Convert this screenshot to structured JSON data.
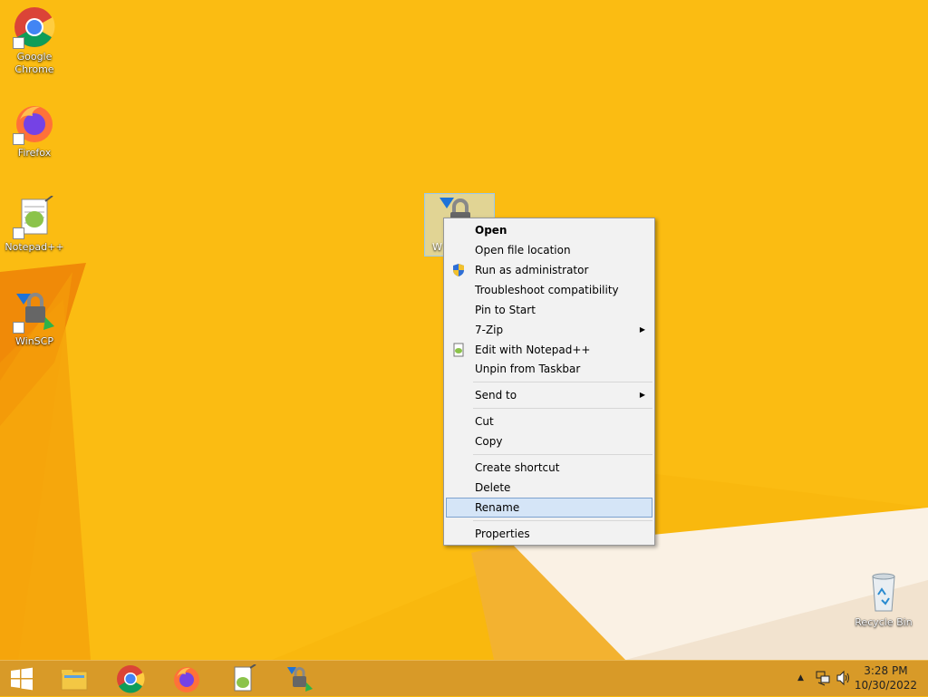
{
  "desktop": {
    "icons": [
      {
        "label": "Google Chrome",
        "icon": "chrome-icon"
      },
      {
        "label": "Firefox",
        "icon": "firefox-icon"
      },
      {
        "label": "Notepad++",
        "icon": "notepadpp-icon"
      },
      {
        "label": "WinSCP",
        "icon": "winscp-icon"
      },
      {
        "label": "Recycle Bin",
        "icon": "recycle-bin-icon"
      }
    ],
    "selected_icon_partial_label": "W"
  },
  "context_menu": {
    "items": [
      {
        "label": "Open",
        "bold": true
      },
      {
        "label": "Open file location"
      },
      {
        "label": "Run as administrator",
        "icon": "uac-shield-icon"
      },
      {
        "label": "Troubleshoot compatibility"
      },
      {
        "label": "Pin to Start"
      },
      {
        "label": "7-Zip",
        "submenu": true
      },
      {
        "label": "Edit with Notepad++",
        "icon": "notepadpp-icon"
      },
      {
        "label": "Unpin from Taskbar"
      },
      {
        "label": "Send to",
        "submenu": true
      },
      {
        "label": "Cut"
      },
      {
        "label": "Copy"
      },
      {
        "label": "Create shortcut"
      },
      {
        "label": "Delete"
      },
      {
        "label": "Rename",
        "highlighted": true
      },
      {
        "label": "Properties"
      }
    ],
    "submenu_arrow": "▶"
  },
  "taskbar": {
    "start_icon": "windows-start-icon",
    "pinned": [
      "file-explorer-icon",
      "chrome-icon",
      "firefox-icon",
      "notepadpp-icon",
      "winscp-icon"
    ],
    "tray": {
      "chevron": "▲",
      "time": "3:28 PM",
      "date": "10/30/2022"
    }
  },
  "colors": {
    "wallpaper": "#f8b70c",
    "taskbar": "#d89a28",
    "menu_bg": "#f2f2f2",
    "highlight": "#d5e5f7"
  }
}
